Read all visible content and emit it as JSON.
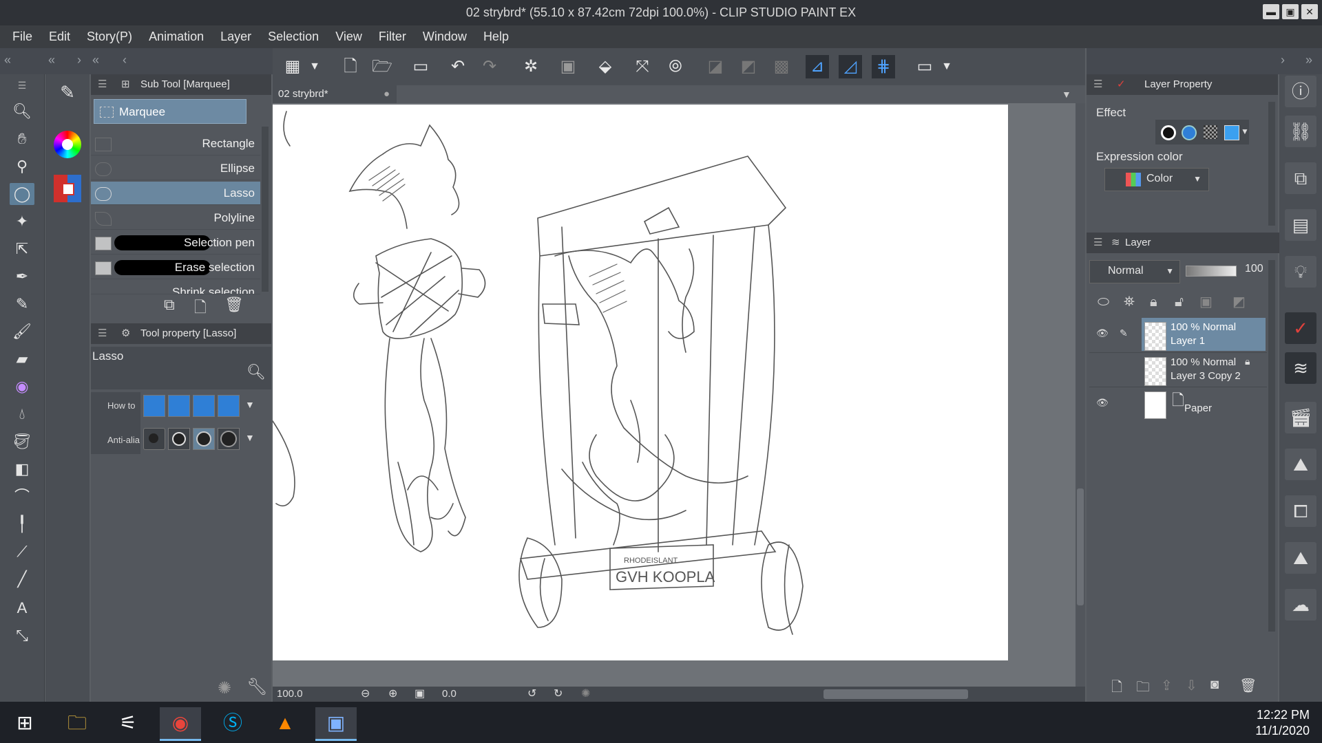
{
  "window": {
    "title": "02 strybrd* (55.10 x 87.42cm 72dpi 100.0%)  - CLIP STUDIO PAINT EX",
    "minimize": "▬",
    "maximize": "▣",
    "close": "✕"
  },
  "menu": [
    "File",
    "Edit",
    "Story(P)",
    "Animation",
    "Layer",
    "Selection",
    "View",
    "Filter",
    "Window",
    "Help"
  ],
  "subtool_panel": {
    "title": "Sub Tool [Marquee]",
    "group_tab": "Marquee",
    "items": [
      "Rectangle",
      "Ellipse",
      "Lasso",
      "Polyline",
      "Selection pen",
      "Erase selection",
      "Shrink selection"
    ],
    "active_item": "Lasso"
  },
  "tool_property": {
    "title": "Tool property [Lasso]",
    "tool_name": "Lasso",
    "how_to_label": "How to",
    "anti_alias_label": "Anti-alia"
  },
  "canvas": {
    "tab_label": "02 strybrd*",
    "sign_top": "RHODEISLANT",
    "sign_main": "GVH KOOPLA"
  },
  "status": {
    "zoom": "100.0",
    "rotation": "0.0"
  },
  "layer_property": {
    "title": "Layer Property",
    "effect_label": "Effect",
    "expression_label": "Expression color",
    "expression_value": "Color"
  },
  "layer_panel": {
    "title": "Layer",
    "blend_mode": "Normal",
    "opacity": "100",
    "layers": [
      {
        "line1": "100 % Normal",
        "line2": "Layer 1",
        "visible": true,
        "selected": true
      },
      {
        "line1": "100 % Normal",
        "line2": "Layer 3 Copy 2",
        "visible": false,
        "selected": false
      },
      {
        "line1": "",
        "line2": "Paper",
        "visible": true,
        "selected": false
      }
    ]
  },
  "taskbar": {
    "time": "12:22 PM",
    "date": "11/1/2020"
  },
  "colors": {
    "accent": "#6d8aa3",
    "panel": "#53575d",
    "foreground": "#1c2b27"
  }
}
